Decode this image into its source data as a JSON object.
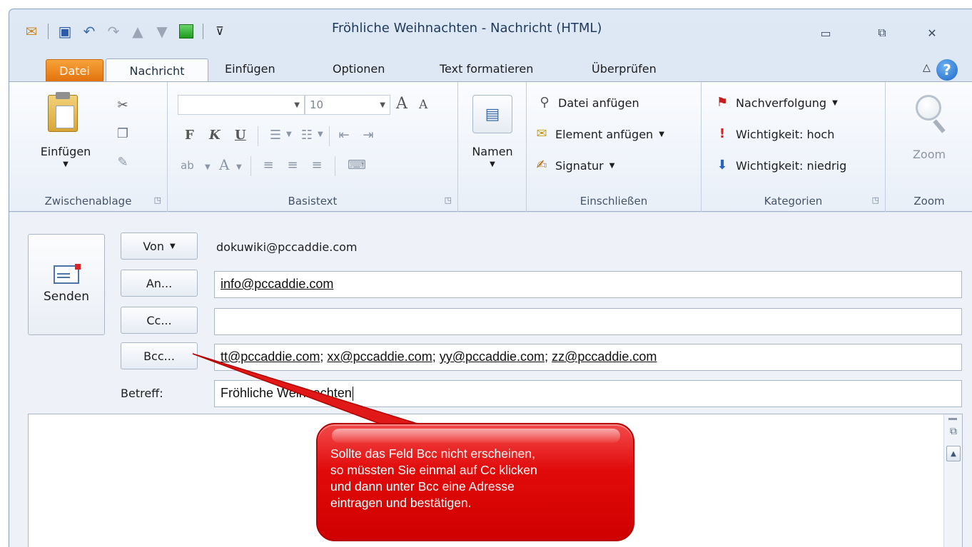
{
  "window": {
    "title": "Fröhliche Weihnachten  -  Nachricht (HTML)",
    "controls": {
      "minimize": "▭",
      "restore": "⧉",
      "close": "✕"
    }
  },
  "quick_access": {
    "icons": [
      "outlook-icon",
      "save-icon",
      "undo-icon",
      "redo-icon",
      "up-arrow-icon",
      "down-arrow-icon",
      "green-square-icon"
    ],
    "customize": "⊽"
  },
  "tabs": {
    "file": "Datei",
    "message": "Nachricht",
    "insert": "Einfügen",
    "options": "Optionen",
    "format_text": "Text formatieren",
    "review": "Überprüfen",
    "collapse": "△"
  },
  "ribbon": {
    "clipboard": {
      "paste": "Einfügen",
      "label": "Zwischenablage"
    },
    "basic_text": {
      "font_name": "",
      "font_size": "10",
      "bold": "F",
      "italic": "K",
      "underline": "U",
      "grow_font": "A",
      "shrink_font": "A",
      "highlight": "ab",
      "font_color": "A",
      "label": "Basistext"
    },
    "names": {
      "label": "Namen"
    },
    "include": {
      "attach_file": "Datei anfügen",
      "attach_item": "Element anfügen",
      "signature": "Signatur",
      "label": "Einschließen"
    },
    "tags": {
      "follow_up": "Nachverfolgung",
      "high_importance": "Wichtigkeit: hoch",
      "low_importance": "Wichtigkeit: niedrig",
      "label": "Kategorien"
    },
    "zoom": {
      "button": "Zoom",
      "label": "Zoom"
    }
  },
  "message": {
    "send": "Senden",
    "from_button": "Von",
    "from_value": "dokuwiki@pccaddie.com",
    "to_button": "An...",
    "to_value": "info@pccaddie.com",
    "cc_button": "Cc...",
    "cc_value": "",
    "bcc_button": "Bcc...",
    "bcc_values": [
      "tt@pccaddie.com",
      "xx@pccaddie.com",
      "yy@pccaddie.com",
      "zz@pccaddie.com"
    ],
    "subject_label": "Betreff:",
    "subject_value": "Fröhliche Weihnachten"
  },
  "callout": {
    "lines": [
      "Sollte das Feld Bcc nicht erscheinen,",
      "so müssten Sie einmal auf Cc klicken",
      "und dann unter Bcc eine Adresse",
      "eintragen und bestätigen."
    ]
  },
  "colors": {
    "file_tab": "#e2710c",
    "callout": "#e10a0a",
    "accent": "#1d66c8"
  }
}
